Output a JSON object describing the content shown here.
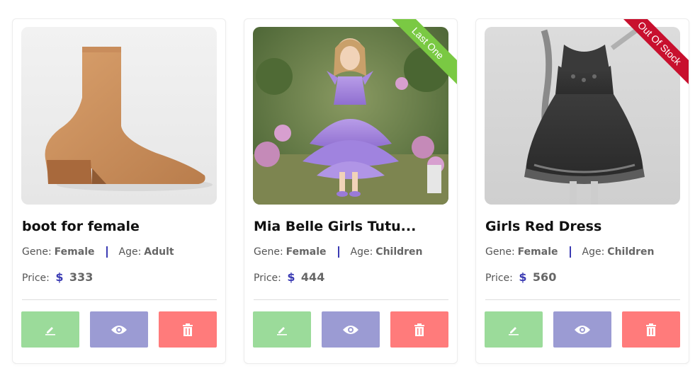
{
  "labels": {
    "gene": "Gene:",
    "age": "Age:",
    "price": "Price:",
    "currency": "$"
  },
  "icons": {
    "edit": "pencil-icon",
    "view": "eye-icon",
    "delete": "trash-icon"
  },
  "colors": {
    "edit_button": "#9bdb9a",
    "view_button": "#9b9bd3",
    "delete_button": "#ff7b7b",
    "accent": "#3b3bb3",
    "ribbon_last_one": "#7ac943",
    "ribbon_out_of_stock": "#c8102e"
  },
  "products": [
    {
      "title": "boot for female",
      "gene": "Female",
      "age": "Adult",
      "price": "333",
      "ribbon": ""
    },
    {
      "title": "Mia Belle Girls Tutu...",
      "gene": "Female",
      "age": "Children",
      "price": "444",
      "ribbon": "Last One"
    },
    {
      "title": "Girls Red Dress",
      "gene": "Female",
      "age": "Children",
      "price": "560",
      "ribbon": "Out Of Stock"
    }
  ]
}
